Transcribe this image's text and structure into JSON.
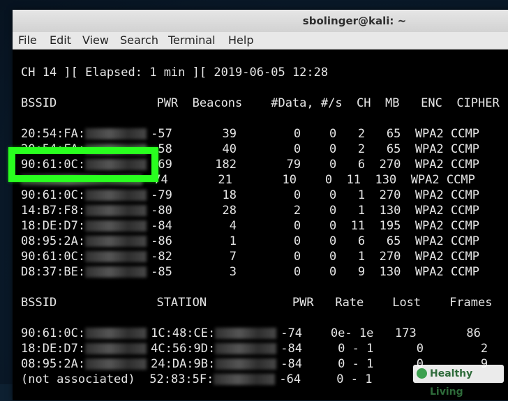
{
  "window": {
    "title": "sbolinger@kali: ~"
  },
  "menu": [
    "File",
    "Edit",
    "View",
    "Search",
    "Terminal",
    "Help"
  ],
  "terminal": {
    "status_line": "CH 14 ][ Elapsed: 1 min ][ 2019-06-05 12:28",
    "ap_header": "BSSID              PWR  Beacons    #Data, #/s  CH  MB   ENC  CIPHER",
    "ap_rows": [
      {
        "bssid": "20:54:FA:",
        "rest": "-57       39        0    0   2   65  WPA2 CCMP"
      },
      {
        "bssid": "20:54:FA:",
        "rest": "-58       40        0    0   2   65  WPA2 CCMP"
      },
      {
        "bssid": "90:61:0C:",
        "rest": "-69      182       79    0   6  270  WPA2 CCMP"
      },
      {
        "bssid": "",
        "rest": "-74       21       10    0  11  130  WPA2 CCMP"
      },
      {
        "bssid": "90:61:0C:",
        "rest": "-79       18        0    0   1  270  WPA2 CCMP"
      },
      {
        "bssid": "14:B7:F8:",
        "rest": "-80       28        2    0   1  130  WPA2 CCMP"
      },
      {
        "bssid": "18:DE:D7:",
        "rest": "-84        4        0    0  11  195  WPA2 CCMP"
      },
      {
        "bssid": "08:95:2A:",
        "rest": "-86        1        0    0   6   65  WPA2 CCMP"
      },
      {
        "bssid": "90:61:0C:",
        "rest": "-82        7        0    0   1  270  WPA2 CCMP"
      },
      {
        "bssid": "D8:37:BE:",
        "rest": "-85        3        0    0   9  130  WPA2 CCMP"
      }
    ],
    "station_header": "BSSID              STATION            PWR   Rate    Lost    Frames",
    "station_rows": [
      {
        "bssid": "90:61:0C:",
        "station": "1C:48:CE:",
        "rest": "-74    0e- 1e   173       86"
      },
      {
        "bssid": "18:DE:D7:",
        "station": "4C:56:9D:",
        "rest": "-84     0 - 1      0        2"
      },
      {
        "bssid": "08:95:2A:",
        "station": "24:DA:9B:",
        "rest": "-84     0 - 1      0        9"
      },
      {
        "bssid": "(not associated)",
        "station": "52:83:5F:",
        "rest": "-64     0 - 1"
      }
    ]
  },
  "watermark": "Healthy Living"
}
